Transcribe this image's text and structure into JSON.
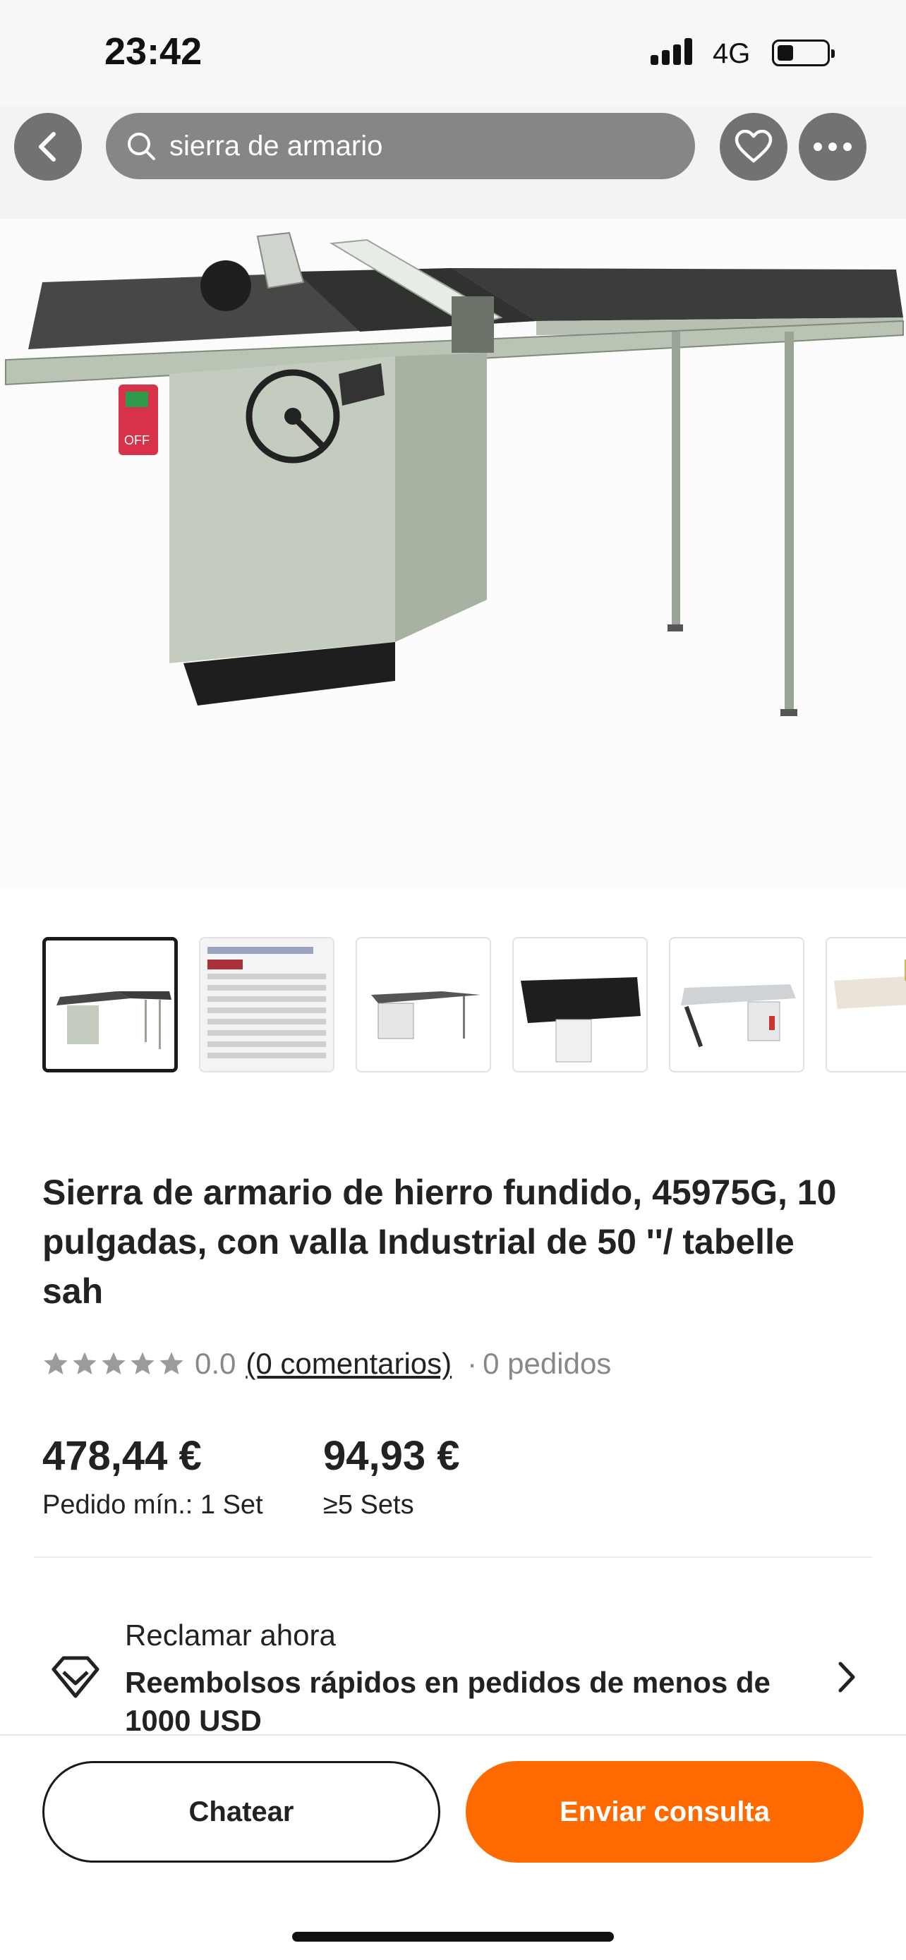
{
  "status_bar": {
    "time": "23:42",
    "network": "4G",
    "battery_level": 0.3
  },
  "search": {
    "query": "sierra de armario"
  },
  "product": {
    "title": "Sierra de armario de hierro fundido, 45975G, 10 pulgadas, con valla Industrial de 50 ''/ tabelle sah",
    "rating_value": "0.0",
    "stars_filled": 0,
    "reviews_label": "(0 comentarios)",
    "orders_label": "0 pedidos",
    "dot": "·"
  },
  "pricing": [
    {
      "price": "478,44 €",
      "condition": "Pedido mín.: 1 Set"
    },
    {
      "price": "94,93 €",
      "condition": "≥5 Sets"
    }
  ],
  "promo": {
    "label": "Reclamar ahora",
    "description": "Reembolsos rápidos en pedidos de menos de 1000 USD"
  },
  "actions": {
    "chat_label": "Chatear",
    "inquiry_label": "Enviar consulta"
  },
  "colors": {
    "accent": "#ff6a00",
    "text": "#222222",
    "muted": "#888888"
  },
  "icons": {
    "back": "back-arrow-icon",
    "search": "search-icon",
    "favorite": "heart-icon",
    "more": "more-dots-icon",
    "promo": "diamond-icon",
    "chevron": "chevron-right-icon"
  }
}
